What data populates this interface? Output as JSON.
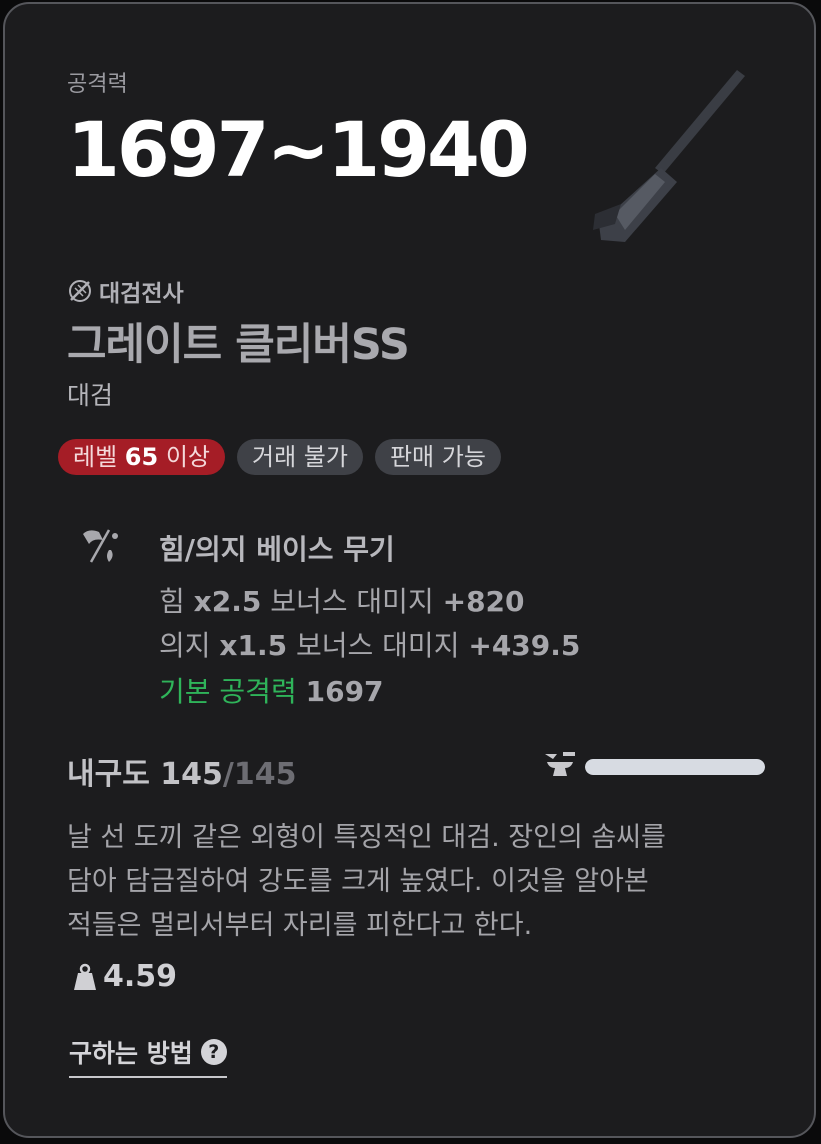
{
  "attack": {
    "label": "공격력",
    "value": "1697~1940"
  },
  "item": {
    "class_icon": "sword-slash-icon",
    "class_name": "대검전사",
    "name": "그레이트 클리버SS",
    "type": "대검"
  },
  "tags": [
    {
      "prefix": "레벨 ",
      "bold": "65",
      "suffix": " 이상",
      "color": "#a51d26"
    },
    {
      "text": "거래 불가"
    },
    {
      "text": "판매 가능"
    }
  ],
  "base": {
    "icon": "strength-will-icon",
    "title": "힘/의지 베이스 무기",
    "stats": [
      {
        "pre": "힘 ",
        "bold": "x2.5",
        "mid": " 보너스 대미지 ",
        "val": "+820"
      },
      {
        "pre": "의지 ",
        "bold": "x1.5",
        "mid": " 보너스 대미지 ",
        "val": "+439.5"
      },
      {
        "pre": "기본 공격력 ",
        "val": "1697",
        "color": "#2fb45a"
      }
    ]
  },
  "durability": {
    "label": "내구도 ",
    "current": "145",
    "max": "/145",
    "fill": 1.0,
    "icon": "anvil-icon"
  },
  "description": "날 선 도끼 같은 외형이 특징적인 대검. 장인의 솜씨를\n담아 담금질하여 강도를 크게 높였다. 이것을 알아본\n적들은 멀리서부터 자리를 피한다고 한다.",
  "weight": {
    "icon": "weight-icon",
    "value": "4.59"
  },
  "howto": {
    "label": "구하는 방법",
    "icon": "question-circle-icon"
  }
}
